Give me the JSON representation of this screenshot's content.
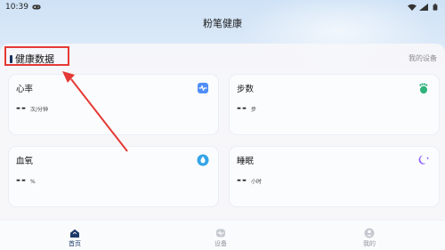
{
  "status": {
    "time": "10:39"
  },
  "app": {
    "title": "粉笔健康"
  },
  "section": {
    "title": "健康数据",
    "link": "我的设备"
  },
  "cards": [
    {
      "label": "心率",
      "value": "--",
      "unit": "次/分钟",
      "icon": "heart-rate-icon",
      "color": "#4f8ef7"
    },
    {
      "label": "步数",
      "value": "--",
      "unit": "步",
      "icon": "footprint-icon",
      "color": "#2fb37b"
    },
    {
      "label": "血氧",
      "value": "--",
      "unit": "%",
      "icon": "droplet-icon",
      "color": "#35a4e8"
    },
    {
      "label": "睡眠",
      "value": "--",
      "unit": "小时",
      "icon": "moon-icon",
      "color": "#8d63ff"
    }
  ],
  "nav": [
    {
      "label": "首页",
      "icon": "home-icon",
      "active": true
    },
    {
      "label": "设备",
      "icon": "device-icon",
      "active": false
    },
    {
      "label": "我的",
      "icon": "profile-icon",
      "active": false
    }
  ],
  "colors": {
    "accent": "#1d3a68",
    "highlight": "#e53935"
  }
}
